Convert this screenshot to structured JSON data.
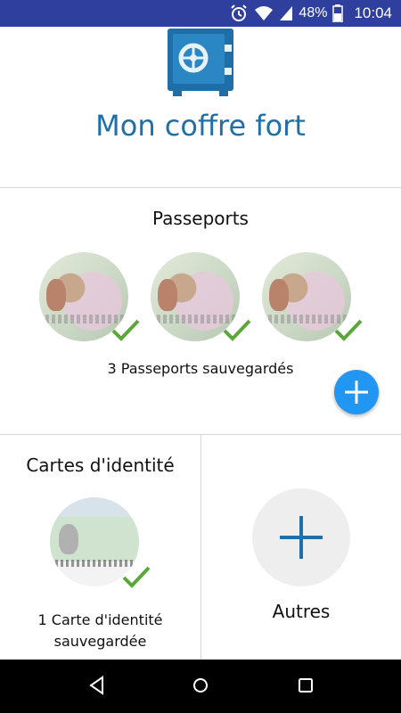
{
  "status_bar": {
    "battery": "48%",
    "time": "10:04",
    "icons": [
      "alarm-icon",
      "wifi-icon",
      "signal-icon",
      "battery-icon"
    ],
    "color": "#2f3f9e"
  },
  "header": {
    "icon": "safe-icon",
    "title": "Mon coffre fort",
    "title_color": "#1f6fa8"
  },
  "passports": {
    "title": "Passeports",
    "count_label": "3 Passeports sauvegardés",
    "items": [
      {
        "saved": true
      },
      {
        "saved": true
      },
      {
        "saved": true
      }
    ],
    "add_button_color": "#2196f3"
  },
  "id_cards": {
    "title": "Cartes d'identité",
    "count_line1": "1 Carte d'identité",
    "count_line2": "sauvegardée",
    "items": [
      {
        "saved": true
      }
    ]
  },
  "others": {
    "label": "Autres",
    "icon": "plus-icon"
  },
  "nav": {
    "buttons": [
      "back-icon",
      "home-icon",
      "recents-icon"
    ]
  },
  "colors": {
    "check_green": "#5aa83a",
    "accent_blue": "#1f6fa8",
    "fab_blue": "#2196f3"
  }
}
